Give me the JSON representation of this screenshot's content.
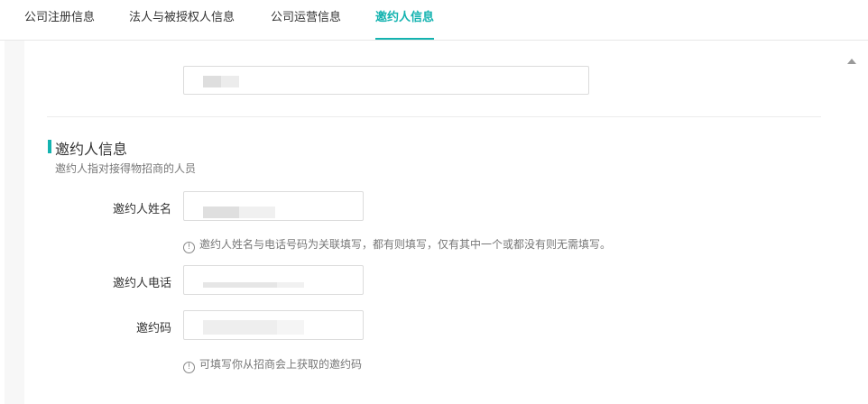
{
  "tabs": [
    {
      "label": "公司注册信息"
    },
    {
      "label": "法人与被授权人信息"
    },
    {
      "label": "公司运营信息"
    },
    {
      "label": "邀约人信息",
      "active": true
    }
  ],
  "section": {
    "title": "邀约人信息",
    "description": "邀约人指对接得物招商的人员"
  },
  "fields": {
    "inviter_name": {
      "label": "邀约人姓名",
      "value": ""
    },
    "inviter_phone": {
      "label": "邀约人电话",
      "value": ""
    },
    "invite_code": {
      "label": "邀约码",
      "value": ""
    }
  },
  "hints": {
    "name_phone": "邀约人姓名与电话号码为关联填写，都有则填写，仅有其中一个或都没有则无需填写。",
    "code": "可填写你从招商会上获取的邀约码",
    "icon_glyph": "!"
  },
  "colors": {
    "accent": "#14b3b0",
    "panel_bg": "#f7f7f7",
    "border": "#dcdcdc"
  }
}
